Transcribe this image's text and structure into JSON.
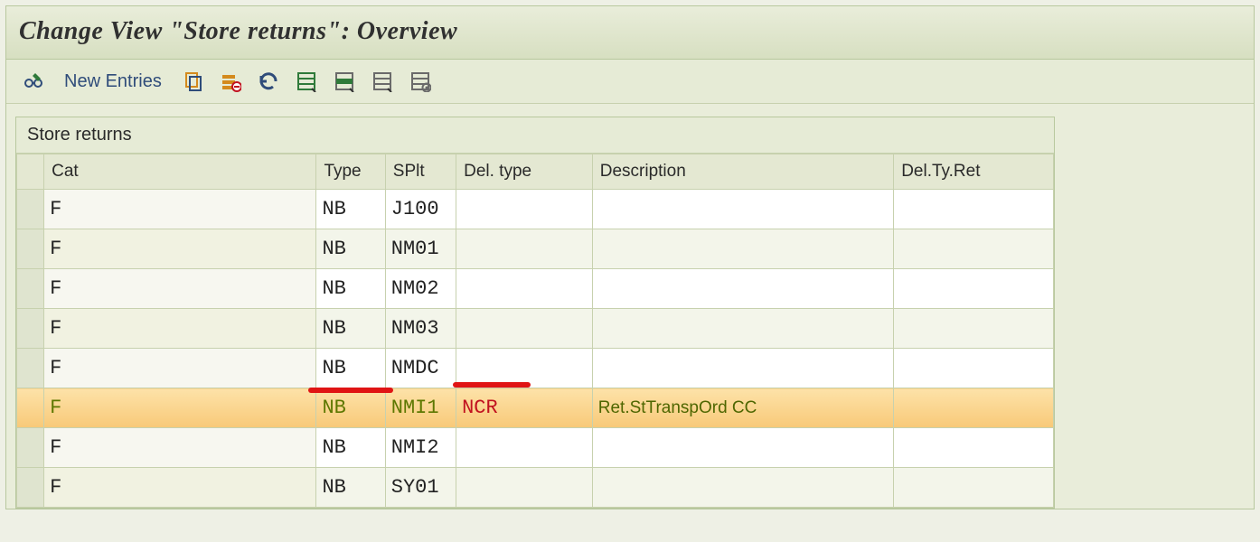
{
  "header": {
    "title": "Change View \"Store returns\": Overview"
  },
  "toolbar": {
    "glasses_label": "Toggle display",
    "new_entries_label": "New Entries",
    "copy_label": "Copy As…",
    "delete_label": "Delete",
    "undo_label": "Undo Change",
    "select_all_label": "Select All",
    "select_block_label": "Select Block",
    "deselect_all_label": "Deselect All",
    "config_label": "Configuration Help"
  },
  "table": {
    "caption": "Store returns",
    "columns": {
      "cat": "Cat",
      "type": "Type",
      "splt": "SPlt",
      "del_type": "Del. type",
      "description": "Description",
      "del_ty_ret": "Del.Ty.Ret"
    },
    "rows": [
      {
        "cat": "F",
        "type": "NB",
        "splt": "J100",
        "del_type": "",
        "description": "",
        "del_ty_ret": "",
        "hot": false
      },
      {
        "cat": "F",
        "type": "NB",
        "splt": "NM01",
        "del_type": "",
        "description": "",
        "del_ty_ret": "",
        "hot": false
      },
      {
        "cat": "F",
        "type": "NB",
        "splt": "NM02",
        "del_type": "",
        "description": "",
        "del_ty_ret": "",
        "hot": false
      },
      {
        "cat": "F",
        "type": "NB",
        "splt": "NM03",
        "del_type": "",
        "description": "",
        "del_ty_ret": "",
        "hot": false
      },
      {
        "cat": "F",
        "type": "NB",
        "splt": "NMDC",
        "del_type": "",
        "description": "",
        "del_ty_ret": "",
        "hot": false
      },
      {
        "cat": "F",
        "type": "NB",
        "splt": "NMI1",
        "del_type": "NCR",
        "description": "Ret.StTranspOrd CC",
        "del_ty_ret": "",
        "hot": true
      },
      {
        "cat": "F",
        "type": "NB",
        "splt": "NMI2",
        "del_type": "",
        "description": "",
        "del_ty_ret": "",
        "hot": false
      },
      {
        "cat": "F",
        "type": "NB",
        "splt": "SY01",
        "del_type": "",
        "description": "",
        "del_ty_ret": "",
        "hot": false
      }
    ]
  }
}
